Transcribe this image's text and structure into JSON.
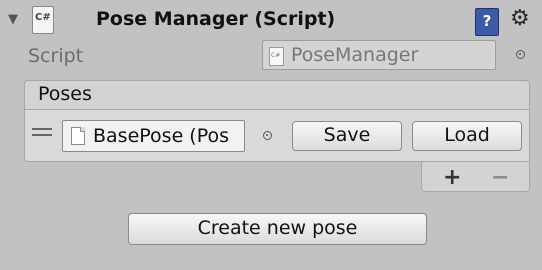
{
  "header": {
    "fold_icon": "triangle-down-icon",
    "script_badge_text": "C#",
    "title": "Pose Manager (Script)",
    "help_icon_text": "?",
    "settings_icon": "gear-icon"
  },
  "script_field": {
    "label": "Script",
    "value": "PoseManager",
    "file_icon_text": "C#"
  },
  "poses_list": {
    "title": "Poses",
    "items": [
      {
        "object_value": "BasePose (Pos",
        "save_label": "Save",
        "load_label": "Load"
      }
    ],
    "add_symbol": "+",
    "remove_symbol": "−"
  },
  "actions": {
    "create_label": "Create new pose"
  }
}
